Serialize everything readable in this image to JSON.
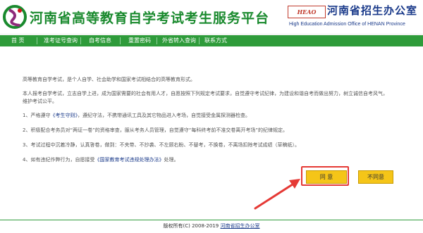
{
  "header": {
    "title": "河南省高等教育自学考试考生服务平台",
    "brand_badge": "HEAO",
    "brand_title": "河南省招生办公室",
    "brand_subtitle": "High Education Admission Office of HENAN Province"
  },
  "nav": {
    "items": [
      "首  页",
      "准考证号查询",
      "自考信息",
      "重置密码",
      "外省转入查询",
      "联系方式"
    ]
  },
  "notice": {
    "intro": "高等教育自学考试，是个人自学、社会助学和国家考试相结合的高等教育形式。",
    "commitment": "本人报考自学考试，立志自学上进，成为国家需要的社会有用人才，自愿按照下列规定考试要求，自觉遵守考试纪律，为建设和谐自考而做出努力，树立诚信自考风气，",
    "commitment_cont": "维护考试公平。",
    "item1_prefix": "1、严格遵守",
    "item1_link": "《考生守则》",
    "item1_suffix": "，遵纪守法，不携带通讯工具及其它物品进入考场，自觉接受金属探测器检查。",
    "item2": "2、积极配合考务员对“两证一卷”的资格审查，服从考务人员管理，自觉遵守“每科终考前不准交卷离开考场”的纪律规定。",
    "item3": "3、考试过程中沉着冷静，认真答卷，做到：不夹带、不抄袭、不左顾右盼、不替考，不换卷，不离场扣除考试成绩（草稿纸）。",
    "item4_prefix": "4、如有违纪作弊行为，自愿接受",
    "item4_link": "《国家教育考试违规处理办法》",
    "item4_suffix": "处理。"
  },
  "buttons": {
    "agree": "同  意",
    "disagree": "不同意"
  },
  "footer": {
    "prefix": "版权所有(C) 2008-2019",
    "link": "河南省招生办公室"
  },
  "colors": {
    "nav_bg": "#2e9b3a",
    "title_green": "#1a8a2e",
    "button_yellow": "#f5c518",
    "annotation_red": "#e53935"
  }
}
